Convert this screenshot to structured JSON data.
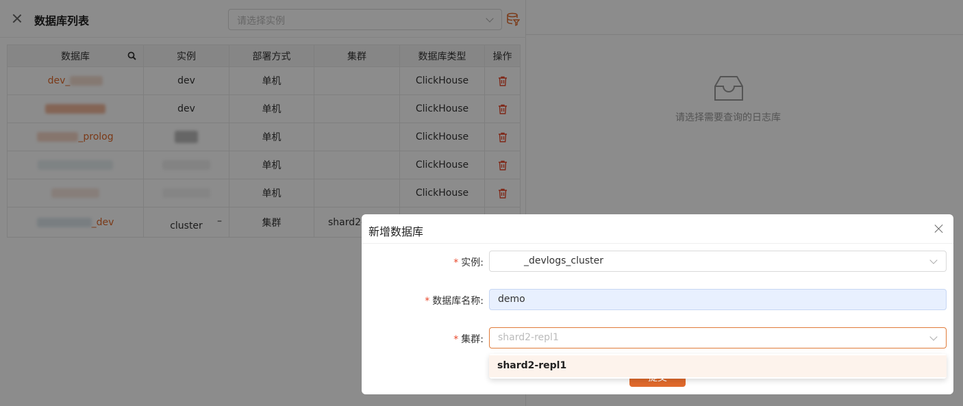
{
  "drawer": {
    "title": "数据库列表",
    "instance_placeholder": "请选择实例"
  },
  "table": {
    "headers": [
      "数据库",
      "实例",
      "部署方式",
      "集群",
      "数据库类型",
      "操作"
    ],
    "rows": [
      {
        "db": "dev_",
        "instance": "dev",
        "deploy": "单机",
        "cluster": "",
        "type": "ClickHouse"
      },
      {
        "db": "",
        "instance": "dev",
        "deploy": "单机",
        "cluster": "",
        "type": "ClickHouse"
      },
      {
        "db": "_prolog",
        "instance": "",
        "deploy": "单机",
        "cluster": "",
        "type": "ClickHouse"
      },
      {
        "db": "",
        "instance": "",
        "deploy": "单机",
        "cluster": "",
        "type": "ClickHouse"
      },
      {
        "db": "",
        "instance": "",
        "deploy": "单机",
        "cluster": "",
        "type": "ClickHouse"
      },
      {
        "db": "_dev",
        "instance": "cluster",
        "deploy": "集群",
        "cluster": "shard2-",
        "type": ""
      }
    ],
    "instance_dash": "–"
  },
  "right_panel": {
    "empty_text": "请选择需要查询的日志库"
  },
  "modal": {
    "title": "新增数据库",
    "instance_label": "实例:",
    "instance_value": "_devlogs_cluster",
    "dbname_label": "数据库名称:",
    "dbname_value": "demo",
    "cluster_label": "集群:",
    "cluster_placeholder": "shard2-repl1",
    "required_mark": "*",
    "submit_label": "提交",
    "dropdown_options": [
      "shard2-repl1"
    ]
  },
  "colors": {
    "accent": "#e06a2c",
    "danger": "#e8472b",
    "autofill_bg": "#e8f0fe"
  }
}
